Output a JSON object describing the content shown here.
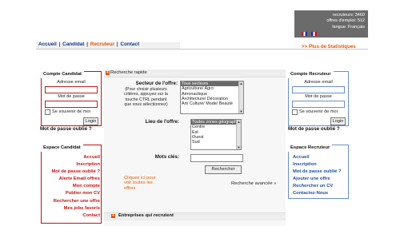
{
  "stats": {
    "recruteurs": "recruteurs: 3460",
    "offres": "offres d'emploi: 512",
    "langue": "langue: Français"
  },
  "nav": {
    "accueil": "Accueil",
    "candidat": "Candidat",
    "recruteur": "Recruteur",
    "contact": "Contact",
    "separator": "|"
  },
  "plus_stats": ">> Plus de Statistiques",
  "candidat_login": {
    "title": "Compte Candidat",
    "email_label": "Adresse email",
    "password_label": "Mot de passe",
    "remember_label": "Se souvenir de moi",
    "login_button": "Login",
    "forgot": "Mot de passe oublié ?"
  },
  "recruteur_login": {
    "title": "Compte Recruteur",
    "email_label": "Adresse email",
    "password_label": "Mot de passe",
    "remember_label": "Se souvenir de moi",
    "login_button": "Login",
    "forgot": "Mot de passe oublié ?"
  },
  "espace_candidat": {
    "title": "Espace Candidat",
    "items": [
      "Accueil",
      "Inscription",
      "Mot de passe oublié ?",
      "Alerte Email offres",
      "Mon compte",
      "Publier mon CV",
      "Rechercher une offre",
      "Mes jobs favoris",
      "Contact"
    ]
  },
  "espace_recruteur": {
    "title": "Espace Recruteur",
    "items": [
      "Accueil",
      "Inscription",
      "Mot de passe oublié ?",
      "Ajouter une offre",
      "Rechercher un CV",
      "Contactez-Nous"
    ]
  },
  "recherche": {
    "title": "Recherche rapide",
    "secteur_label": "Secteur de l'offre:",
    "secteur_hint": "(Pour choisir plusieurs critères, appuyez sur la touche CTRL pendant que vous sélectionnez)",
    "secteur_options": [
      "Tous secteurs",
      "Agriculture/ Agro",
      "Aéronautique",
      "Architecture/ Décoration",
      "Art/ Culture/ Mode/ Beauté"
    ],
    "lieu_label": "Lieu de l'offre:",
    "lieu_options": [
      "Toutes zones géographiques",
      "Centre",
      "Est",
      "Ouest",
      "Sud"
    ],
    "mots_label": "Mots clés:",
    "mots_value": "",
    "search_button": "Rechercher",
    "all_offers_link": "Cliquez ici pour voir toutes les offres",
    "advanced": "Recherche avancée »"
  },
  "entreprises": {
    "title": "Entreprises qui recrutent"
  },
  "colors": {
    "accent_orange": "#e05a00",
    "candidat_red": "#c81010",
    "recruteur_blue": "#1c4ea8"
  }
}
